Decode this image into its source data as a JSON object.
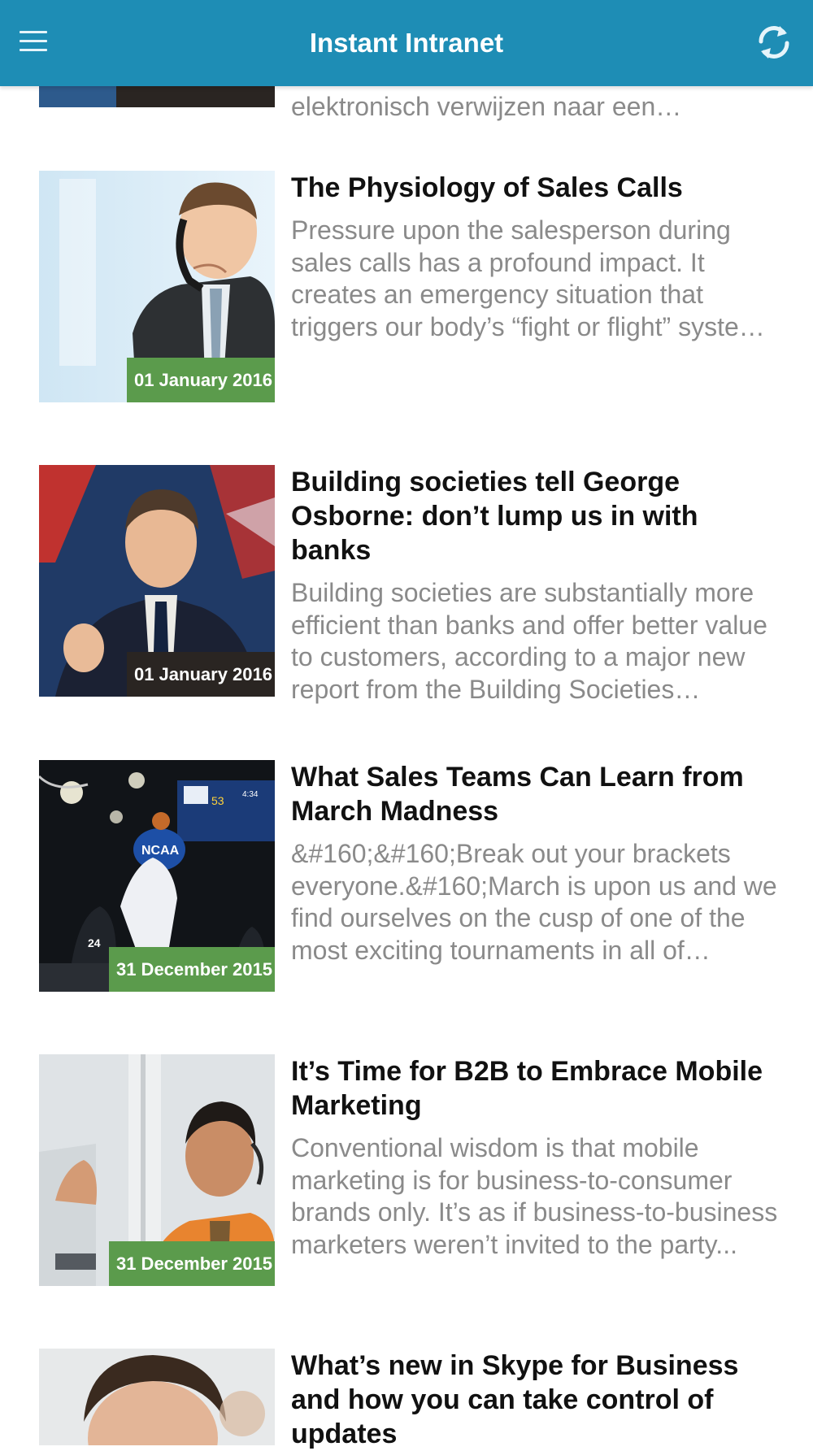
{
  "appbar": {
    "title": "Instant Intranet",
    "menu_icon": "hamburger-menu-icon",
    "refresh_icon": "refresh-icon"
  },
  "partial_top_excerpt": "elektronisch verwijzen naar een gespecialiseerd...",
  "articles": [
    {
      "title": "The Physiology of Sales Calls",
      "excerpt": "Pressure upon the salesperson during sales calls has a profound impact. It creates an emergency situation that triggers our body’s “fight or flight” system and ...",
      "date": "01 January 2016",
      "badge_color": "#5b9b4c"
    },
    {
      "title": "Building societies tell George Osborne: don’t lump us in with banks",
      "excerpt": "Building societies are substantially more efficient than banks and offer better value to customers, according to a major new report from the Building Societies Association...",
      "date": "01 January 2016",
      "badge_color": "#2a2522"
    },
    {
      "title": "What Sales Teams Can Learn from March Madness",
      "excerpt": "&#160;&#160;Break out your brackets everyone.&#160;March is upon us and we find ourselves on the cusp of one of the most exciting tournaments in all of sports...",
      "date": "31 December 2015",
      "badge_color": "#5b9b4c"
    },
    {
      "title": "It’s Time for B2B to Embrace Mobile Marketing",
      "excerpt": "Conventional wisdom is that mobile marketing is for business-to-consumer brands only. It’s as if business-to-business marketers weren’t invited to the party...",
      "date": "31 December 2015",
      "badge_color": "#5b9b4c"
    },
    {
      "title": "What’s new in Skype for Business and how you can take control of updates",
      "excerpt": "",
      "date": "",
      "badge_color": "#5b9b4c"
    }
  ]
}
